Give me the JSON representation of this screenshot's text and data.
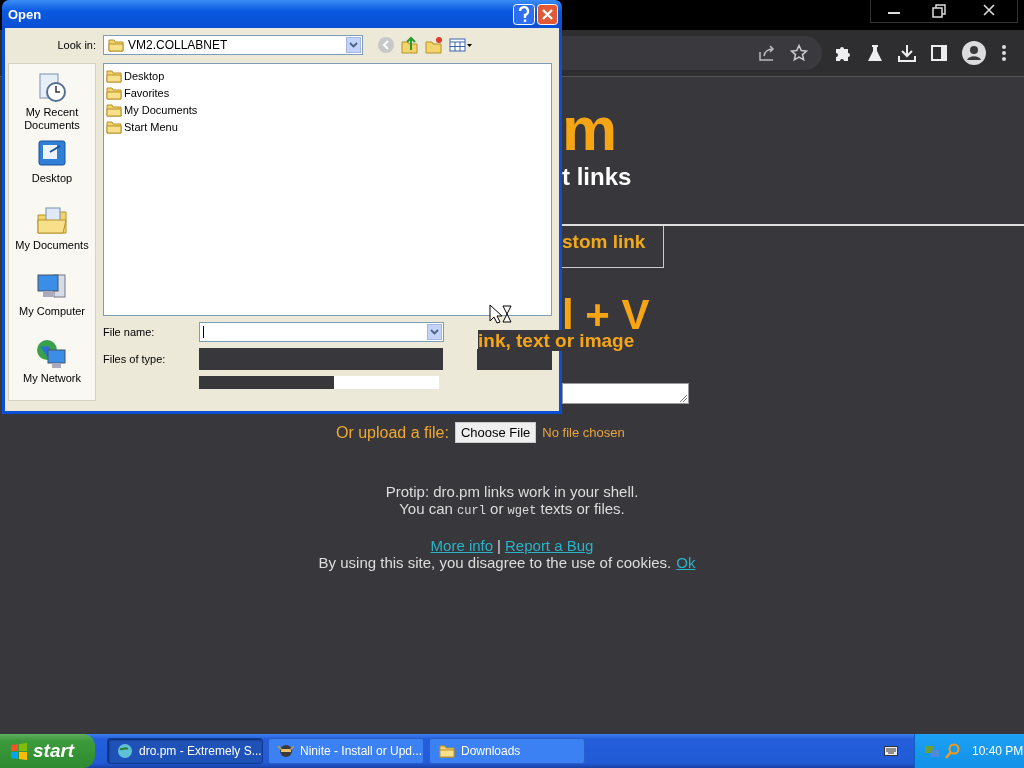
{
  "page": {
    "heading_fragment": "m",
    "tagline_fragment": "t links",
    "tab_fragment": "stom link",
    "shortcut_fragment": "l + V",
    "hint_fragment": "ink, text or image",
    "upload_label": "Or upload a file:",
    "choose_file_button": "Choose File",
    "no_file_text": "No file chosen",
    "protip": [
      [
        {
          "kind": "text",
          "text": "Protip: dro.pm links work in your shell."
        }
      ],
      [
        {
          "kind": "text",
          "text": "You can "
        },
        {
          "kind": "code",
          "text": "curl"
        },
        {
          "kind": "text",
          "text": " or "
        },
        {
          "kind": "code",
          "text": "wget"
        },
        {
          "kind": "text",
          "text": " texts or files."
        }
      ]
    ],
    "more_info_link": "More info",
    "link_separator": "|",
    "report_bug_link": "Report a Bug",
    "cookie_text": "By using this site, you disagree to the use of cookies.",
    "cookie_ok_link": "Ok"
  },
  "dialog": {
    "title": "Open",
    "look_in_label": "Look in:",
    "look_in_value": "VM2.COLLABNET",
    "back_disabled": true,
    "places": [
      {
        "kind": "recent",
        "label": "My Recent Documents"
      },
      {
        "kind": "desktop",
        "label": "Desktop"
      },
      {
        "kind": "documents",
        "label": "My Documents"
      },
      {
        "kind": "computer",
        "label": "My Computer"
      },
      {
        "kind": "network",
        "label": "My Network"
      }
    ],
    "files": [
      "Desktop",
      "Favorites",
      "My Documents",
      "Start Menu"
    ],
    "file_name_label": "File name:",
    "files_of_type_label": "Files of type:"
  },
  "taskbar": {
    "start": "start",
    "tasks": [
      {
        "kind": "browser",
        "label": "dro.pm - Extremely S...",
        "selected": true
      },
      {
        "kind": "ninja",
        "label": "Ninite - Install or Upd...",
        "selected": false
      },
      {
        "kind": "folder",
        "label": "Downloads",
        "selected": false
      }
    ],
    "clock": "10:40 PM"
  }
}
